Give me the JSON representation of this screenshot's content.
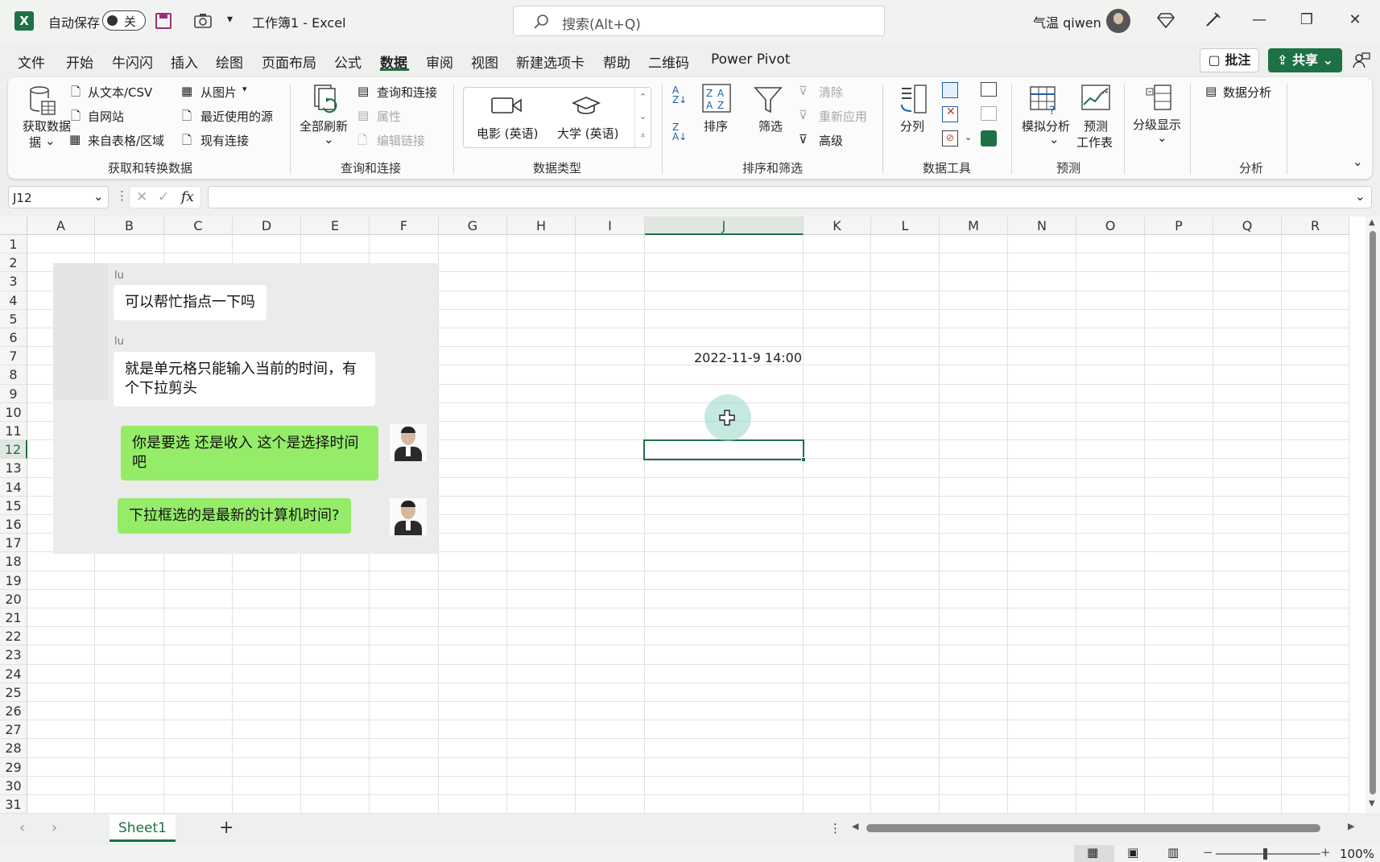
{
  "titlebar": {
    "autosave_label": "自动保存",
    "autosave_state": "关",
    "doc_title": "工作簿1  -  Excel",
    "search_placeholder": "搜索(Alt+Q)",
    "user_name": "气温 qiwen"
  },
  "menu": {
    "items": [
      "文件",
      "开始",
      "牛闪闪",
      "插入",
      "绘图",
      "页面布局",
      "公式",
      "数据",
      "审阅",
      "视图",
      "新建选项卡",
      "帮助",
      "二维码",
      "Power Pivot"
    ],
    "active": "数据",
    "comments_label": "批注",
    "share_label": "共享"
  },
  "ribbon": {
    "get_data": "获取数据",
    "get_data_line2": "据",
    "from_text_csv": "从文本/CSV",
    "from_web": "自网站",
    "from_table": "来自表格/区域",
    "from_picture": "从图片",
    "recent_sources": "最近使用的源",
    "existing_connections": "现有连接",
    "group_get_transform": "获取和转换数据",
    "refresh_all": "全部刷新",
    "queries_connections": "查询和连接",
    "properties": "属性",
    "edit_links": "编辑链接",
    "group_queries": "查询和连接",
    "dt_movies": "电影 (英语)",
    "dt_universities": "大学 (英语)",
    "group_data_types": "数据类型",
    "sort": "排序",
    "filter": "筛选",
    "clear": "清除",
    "reapply": "重新应用",
    "advanced": "高级",
    "group_sort_filter": "排序和筛选",
    "text_to_columns": "分列",
    "group_data_tools": "数据工具",
    "what_if": "模拟分析",
    "forecast_sheet": "预测",
    "forecast_sheet_2": "工作表",
    "group_forecast": "预测",
    "outline": "分级显示",
    "data_analysis": "数据分析",
    "group_analysis": "分析"
  },
  "formula_bar": {
    "name_box": "J12",
    "fx": "fx",
    "content": ""
  },
  "sheet": {
    "columns": [
      "A",
      "B",
      "C",
      "D",
      "E",
      "F",
      "G",
      "H",
      "I",
      "J",
      "K",
      "L",
      "M",
      "N",
      "O",
      "P",
      "Q",
      "R"
    ],
    "selected_column": "J",
    "rows": [
      "1",
      "2",
      "3",
      "4",
      "5",
      "6",
      "7",
      "8",
      "9",
      "10",
      "11",
      "12",
      "13",
      "14",
      "15",
      "16",
      "17",
      "18",
      "19",
      "20",
      "21",
      "22",
      "23",
      "24",
      "25",
      "26",
      "27",
      "28",
      "29",
      "30",
      "31"
    ],
    "selected_row": "12",
    "cell_j7": "2022-11-9 14:00"
  },
  "chat": {
    "sender1": "lu",
    "msg1": "可以帮忙指点一下吗",
    "sender2": "lu",
    "msg2": "就是单元格只能输入当前的时间，有个下拉剪头",
    "msg3": "你是要选 还是收入 这个是选择时间吧",
    "msg4": "下拉框选的是最新的计算机时间?"
  },
  "tabs": {
    "sheet1": "Sheet1",
    "add": "+"
  },
  "status": {
    "zoom": "100%"
  },
  "colors": {
    "accent": "#1e7145",
    "bubble_out": "#95ec69"
  }
}
